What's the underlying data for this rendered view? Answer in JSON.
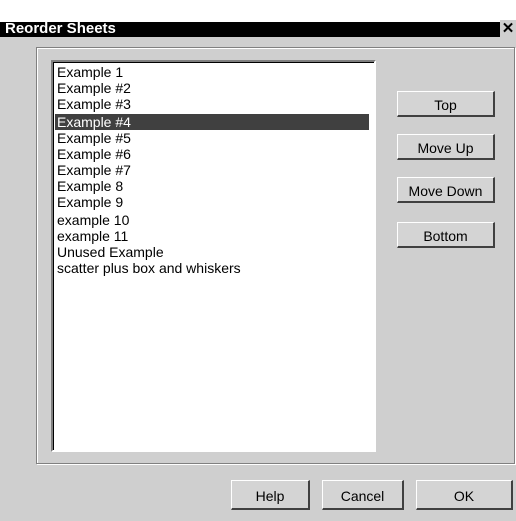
{
  "dialog": {
    "title": "Reorder Sheets",
    "close_glyph": "✕"
  },
  "list": {
    "items": [
      "Example 1",
      "Example #2",
      "Example #3",
      "Example #4",
      "Example #5",
      "Example #6",
      "Example #7",
      "Example 8",
      "Example 9",
      "example 10",
      "example 11",
      "Unused Example",
      "scatter plus box and whiskers"
    ],
    "selected_index": 3
  },
  "buttons": {
    "top": "Top",
    "move_up": "Move Up",
    "move_down": "Move Down",
    "bottom": "Bottom",
    "help": "Help",
    "cancel": "Cancel",
    "ok": "OK"
  }
}
